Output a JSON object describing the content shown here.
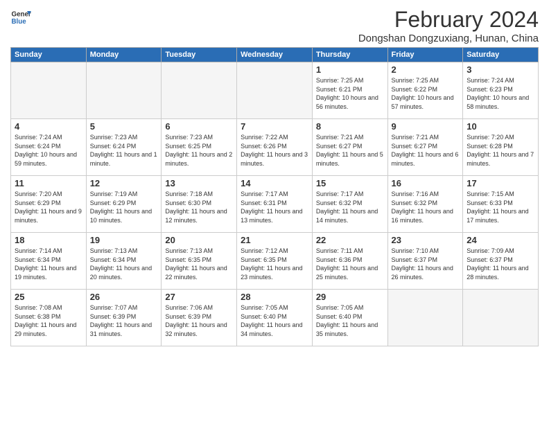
{
  "logo": {
    "general": "General",
    "blue": "Blue"
  },
  "title": "February 2024",
  "location": "Dongshan Dongzuxiang, Hunan, China",
  "days_of_week": [
    "Sunday",
    "Monday",
    "Tuesday",
    "Wednesday",
    "Thursday",
    "Friday",
    "Saturday"
  ],
  "weeks": [
    [
      {
        "day": "",
        "info": ""
      },
      {
        "day": "",
        "info": ""
      },
      {
        "day": "",
        "info": ""
      },
      {
        "day": "",
        "info": ""
      },
      {
        "day": "1",
        "info": "Sunrise: 7:25 AM\nSunset: 6:21 PM\nDaylight: 10 hours and 56 minutes."
      },
      {
        "day": "2",
        "info": "Sunrise: 7:25 AM\nSunset: 6:22 PM\nDaylight: 10 hours and 57 minutes."
      },
      {
        "day": "3",
        "info": "Sunrise: 7:24 AM\nSunset: 6:23 PM\nDaylight: 10 hours and 58 minutes."
      }
    ],
    [
      {
        "day": "4",
        "info": "Sunrise: 7:24 AM\nSunset: 6:24 PM\nDaylight: 10 hours and 59 minutes."
      },
      {
        "day": "5",
        "info": "Sunrise: 7:23 AM\nSunset: 6:24 PM\nDaylight: 11 hours and 1 minute."
      },
      {
        "day": "6",
        "info": "Sunrise: 7:23 AM\nSunset: 6:25 PM\nDaylight: 11 hours and 2 minutes."
      },
      {
        "day": "7",
        "info": "Sunrise: 7:22 AM\nSunset: 6:26 PM\nDaylight: 11 hours and 3 minutes."
      },
      {
        "day": "8",
        "info": "Sunrise: 7:21 AM\nSunset: 6:27 PM\nDaylight: 11 hours and 5 minutes."
      },
      {
        "day": "9",
        "info": "Sunrise: 7:21 AM\nSunset: 6:27 PM\nDaylight: 11 hours and 6 minutes."
      },
      {
        "day": "10",
        "info": "Sunrise: 7:20 AM\nSunset: 6:28 PM\nDaylight: 11 hours and 7 minutes."
      }
    ],
    [
      {
        "day": "11",
        "info": "Sunrise: 7:20 AM\nSunset: 6:29 PM\nDaylight: 11 hours and 9 minutes."
      },
      {
        "day": "12",
        "info": "Sunrise: 7:19 AM\nSunset: 6:29 PM\nDaylight: 11 hours and 10 minutes."
      },
      {
        "day": "13",
        "info": "Sunrise: 7:18 AM\nSunset: 6:30 PM\nDaylight: 11 hours and 12 minutes."
      },
      {
        "day": "14",
        "info": "Sunrise: 7:17 AM\nSunset: 6:31 PM\nDaylight: 11 hours and 13 minutes."
      },
      {
        "day": "15",
        "info": "Sunrise: 7:17 AM\nSunset: 6:32 PM\nDaylight: 11 hours and 14 minutes."
      },
      {
        "day": "16",
        "info": "Sunrise: 7:16 AM\nSunset: 6:32 PM\nDaylight: 11 hours and 16 minutes."
      },
      {
        "day": "17",
        "info": "Sunrise: 7:15 AM\nSunset: 6:33 PM\nDaylight: 11 hours and 17 minutes."
      }
    ],
    [
      {
        "day": "18",
        "info": "Sunrise: 7:14 AM\nSunset: 6:34 PM\nDaylight: 11 hours and 19 minutes."
      },
      {
        "day": "19",
        "info": "Sunrise: 7:13 AM\nSunset: 6:34 PM\nDaylight: 11 hours and 20 minutes."
      },
      {
        "day": "20",
        "info": "Sunrise: 7:13 AM\nSunset: 6:35 PM\nDaylight: 11 hours and 22 minutes."
      },
      {
        "day": "21",
        "info": "Sunrise: 7:12 AM\nSunset: 6:35 PM\nDaylight: 11 hours and 23 minutes."
      },
      {
        "day": "22",
        "info": "Sunrise: 7:11 AM\nSunset: 6:36 PM\nDaylight: 11 hours and 25 minutes."
      },
      {
        "day": "23",
        "info": "Sunrise: 7:10 AM\nSunset: 6:37 PM\nDaylight: 11 hours and 26 minutes."
      },
      {
        "day": "24",
        "info": "Sunrise: 7:09 AM\nSunset: 6:37 PM\nDaylight: 11 hours and 28 minutes."
      }
    ],
    [
      {
        "day": "25",
        "info": "Sunrise: 7:08 AM\nSunset: 6:38 PM\nDaylight: 11 hours and 29 minutes."
      },
      {
        "day": "26",
        "info": "Sunrise: 7:07 AM\nSunset: 6:39 PM\nDaylight: 11 hours and 31 minutes."
      },
      {
        "day": "27",
        "info": "Sunrise: 7:06 AM\nSunset: 6:39 PM\nDaylight: 11 hours and 32 minutes."
      },
      {
        "day": "28",
        "info": "Sunrise: 7:05 AM\nSunset: 6:40 PM\nDaylight: 11 hours and 34 minutes."
      },
      {
        "day": "29",
        "info": "Sunrise: 7:05 AM\nSunset: 6:40 PM\nDaylight: 11 hours and 35 minutes."
      },
      {
        "day": "",
        "info": ""
      },
      {
        "day": "",
        "info": ""
      }
    ]
  ]
}
